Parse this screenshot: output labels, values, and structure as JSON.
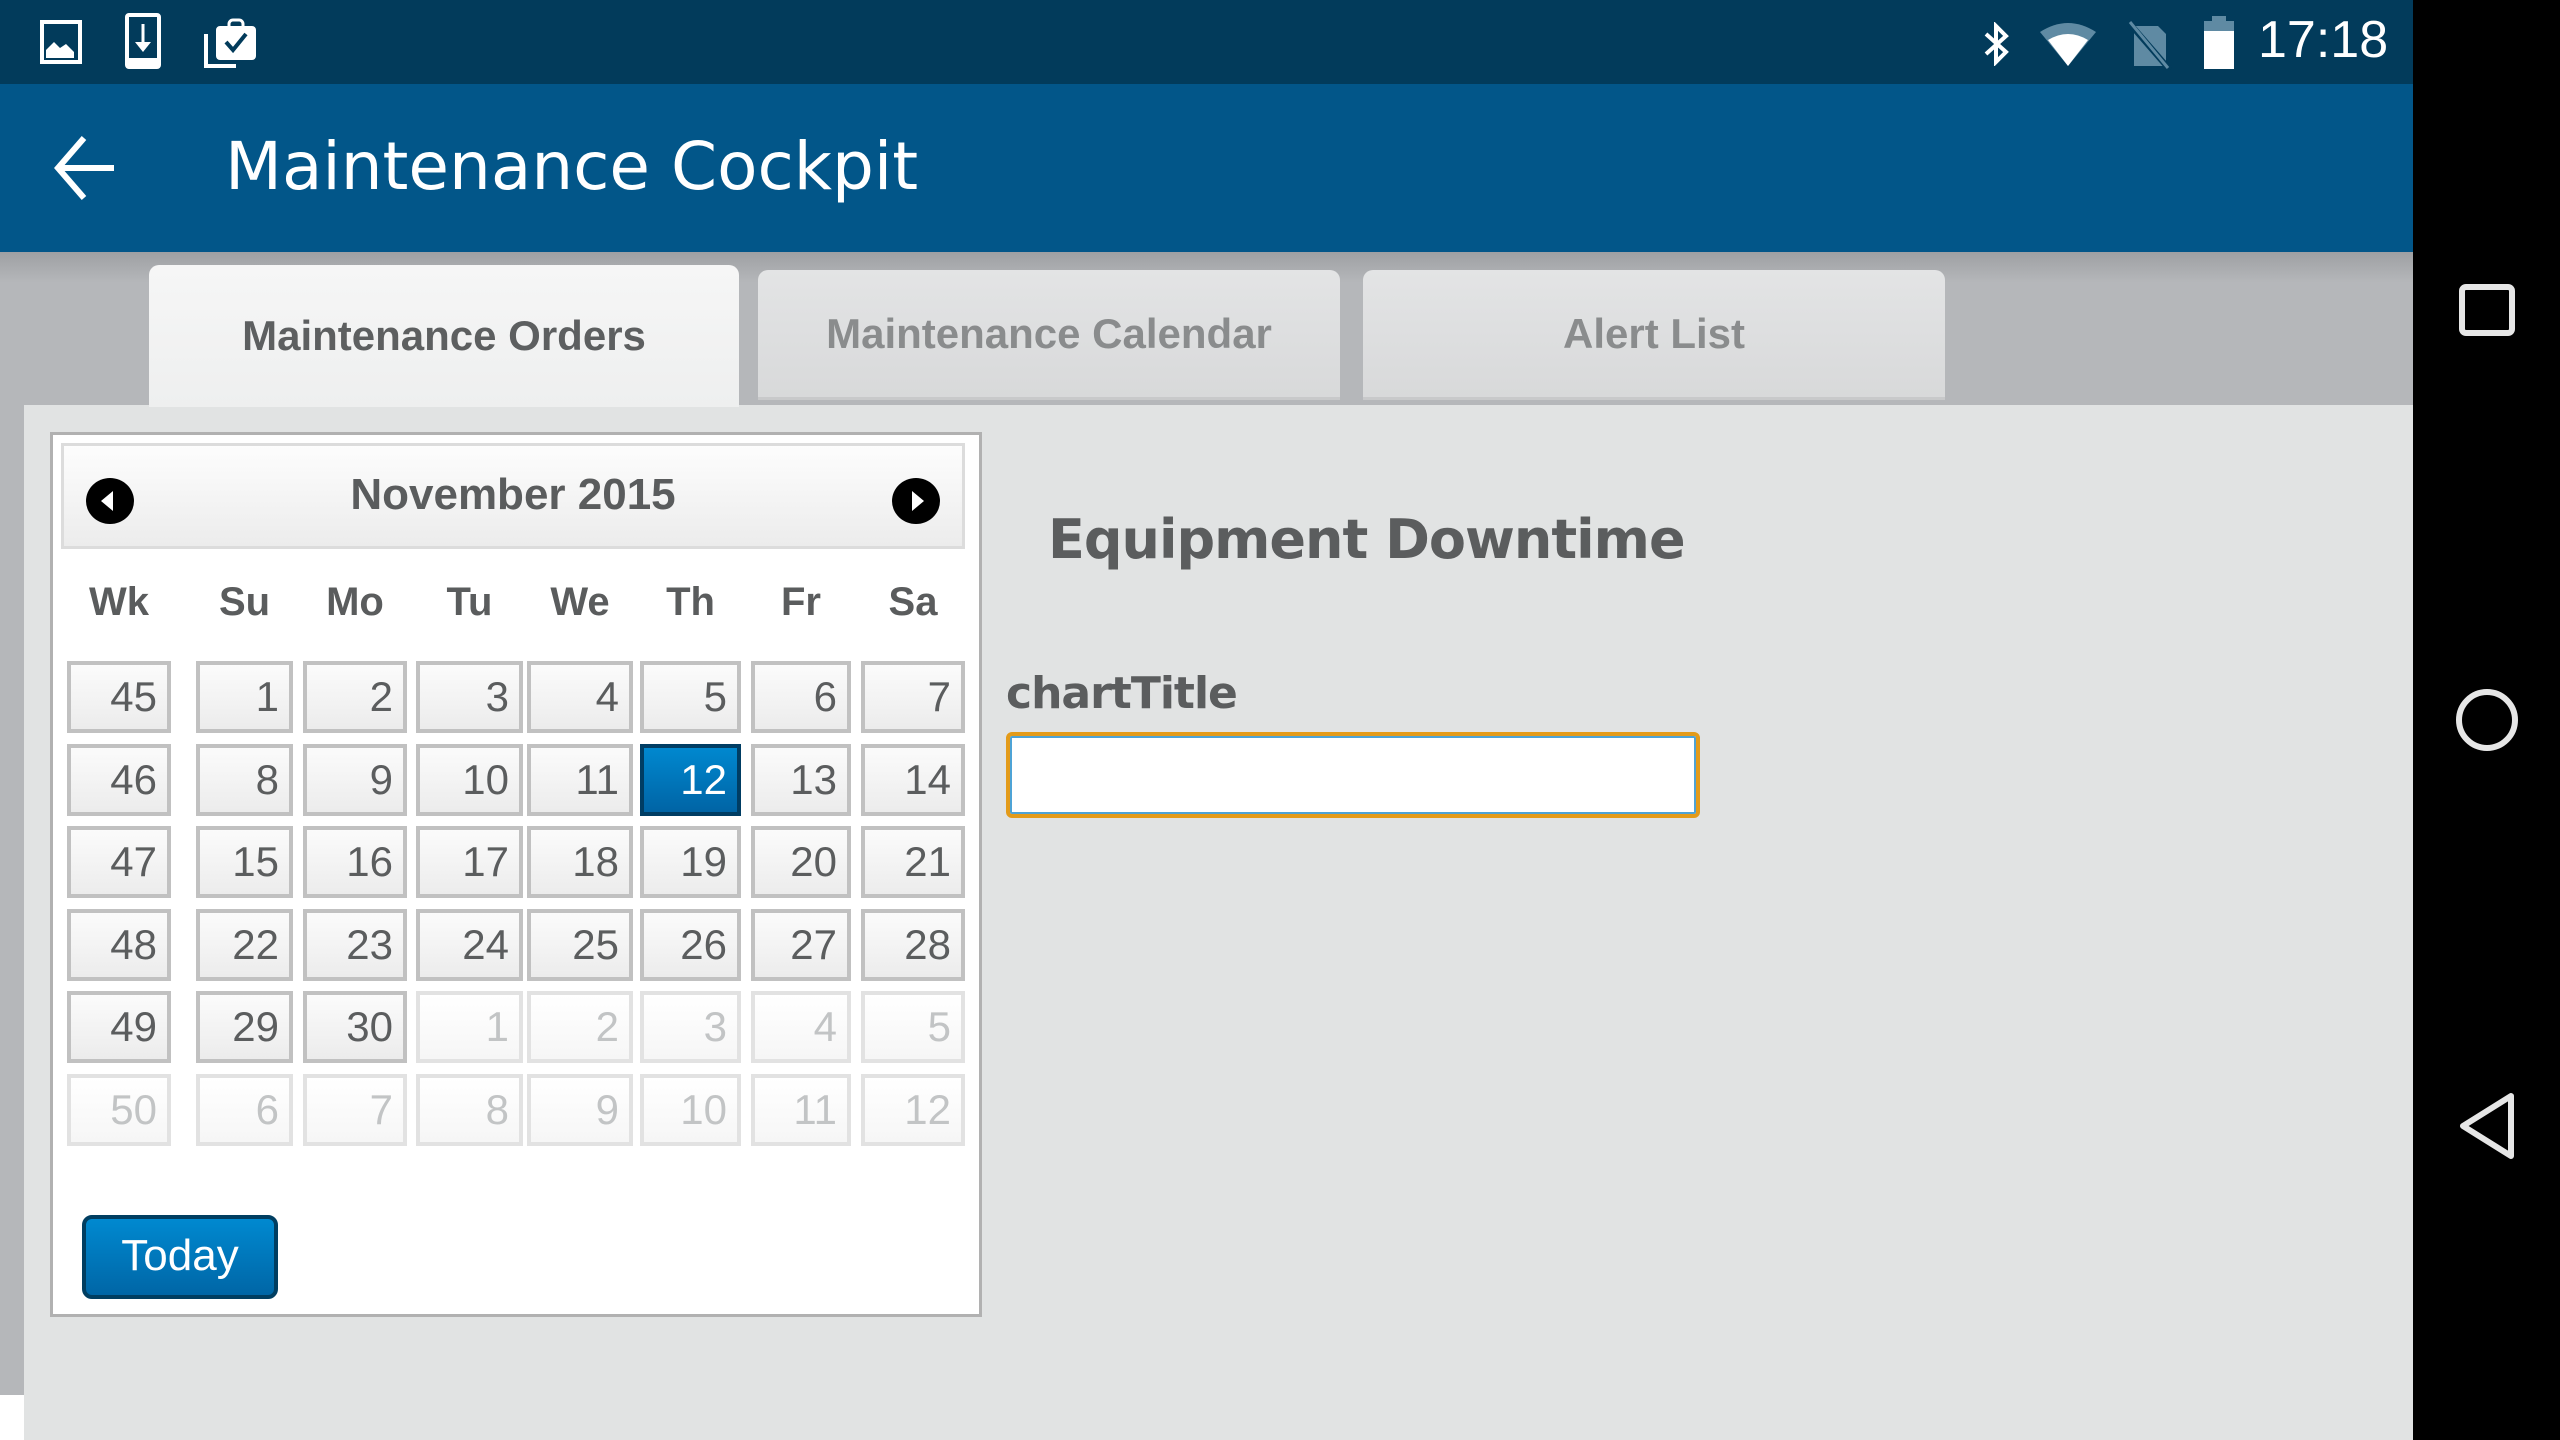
{
  "status_bar": {
    "left_icons": [
      "image-icon",
      "download-icon",
      "clipboard-check-icon"
    ],
    "right_icons": [
      "bluetooth-icon",
      "wifi-icon",
      "no-sim-icon",
      "battery-icon"
    ],
    "time": "17:18"
  },
  "app_bar": {
    "title": "Maintenance Cockpit",
    "back_icon": "arrow-left-icon"
  },
  "tabs": [
    {
      "label": "Maintenance Orders",
      "active": true
    },
    {
      "label": "Maintenance Calendar",
      "active": false
    },
    {
      "label": "Alert List",
      "active": false
    }
  ],
  "calendar": {
    "month_label": "November 2015",
    "prev_icon": "chevron-left-circle-icon",
    "next_icon": "chevron-right-circle-icon",
    "weekday_headers": [
      "Wk",
      "Su",
      "Mo",
      "Tu",
      "We",
      "Th",
      "Fr",
      "Sa"
    ],
    "weeks": [
      {
        "wk": "45",
        "days": [
          "1",
          "2",
          "3",
          "4",
          "5",
          "6",
          "7"
        ],
        "other": [
          false,
          false,
          false,
          false,
          false,
          false,
          false
        ]
      },
      {
        "wk": "46",
        "days": [
          "8",
          "9",
          "10",
          "11",
          "12",
          "13",
          "14"
        ],
        "other": [
          false,
          false,
          false,
          false,
          false,
          false,
          false
        ]
      },
      {
        "wk": "47",
        "days": [
          "15",
          "16",
          "17",
          "18",
          "19",
          "20",
          "21"
        ],
        "other": [
          false,
          false,
          false,
          false,
          false,
          false,
          false
        ]
      },
      {
        "wk": "48",
        "days": [
          "22",
          "23",
          "24",
          "25",
          "26",
          "27",
          "28"
        ],
        "other": [
          false,
          false,
          false,
          false,
          false,
          false,
          false
        ]
      },
      {
        "wk": "49",
        "days": [
          "29",
          "30",
          "1",
          "2",
          "3",
          "4",
          "5"
        ],
        "other": [
          false,
          false,
          true,
          true,
          true,
          true,
          true
        ]
      },
      {
        "wk": "50",
        "days": [
          "6",
          "7",
          "8",
          "9",
          "10",
          "11",
          "12"
        ],
        "other": [
          true,
          true,
          true,
          true,
          true,
          true,
          true
        ],
        "wk_other": true
      }
    ],
    "selected": {
      "week_index": 1,
      "day_index": 4,
      "value": "12"
    },
    "today_button": "Today"
  },
  "main": {
    "section_title": "Equipment Downtime",
    "field_label": "chartTitle",
    "field_value": "",
    "field_placeholder": ""
  },
  "colors": {
    "status_bar": "#023b5b",
    "app_bar": "#025689",
    "selected_day": "#0077bd",
    "input_focus_border": "#e39b1a"
  },
  "nav_bar": {
    "buttons": [
      "recent-apps-icon",
      "home-icon",
      "back-icon"
    ]
  }
}
